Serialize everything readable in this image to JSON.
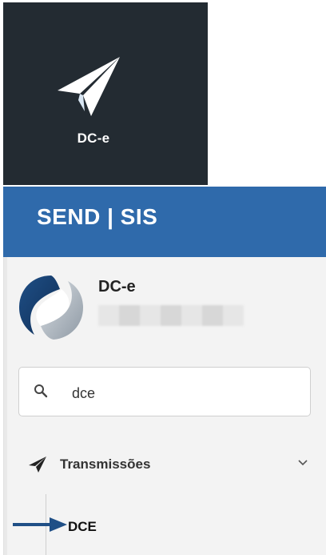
{
  "app_tile": {
    "label": "DC-e",
    "icon": "paper-plane-icon"
  },
  "header": {
    "brand": "SEND | SIS"
  },
  "profile": {
    "name": "DC-e",
    "avatar_icon": "company-logo"
  },
  "search": {
    "value": "dce",
    "icon": "search-icon"
  },
  "nav": {
    "group_label": "Transmissões",
    "group_icon": "send-icon",
    "chevron_icon": "chevron-down-icon",
    "items": [
      {
        "label": "DCE"
      }
    ]
  },
  "annotation": {
    "icon": "arrow-right-icon",
    "color": "#1f4f86"
  },
  "colors": {
    "tile_bg": "#232b32",
    "header_bg": "#2f6aab",
    "sidebar_bg": "#f3f3f3"
  }
}
